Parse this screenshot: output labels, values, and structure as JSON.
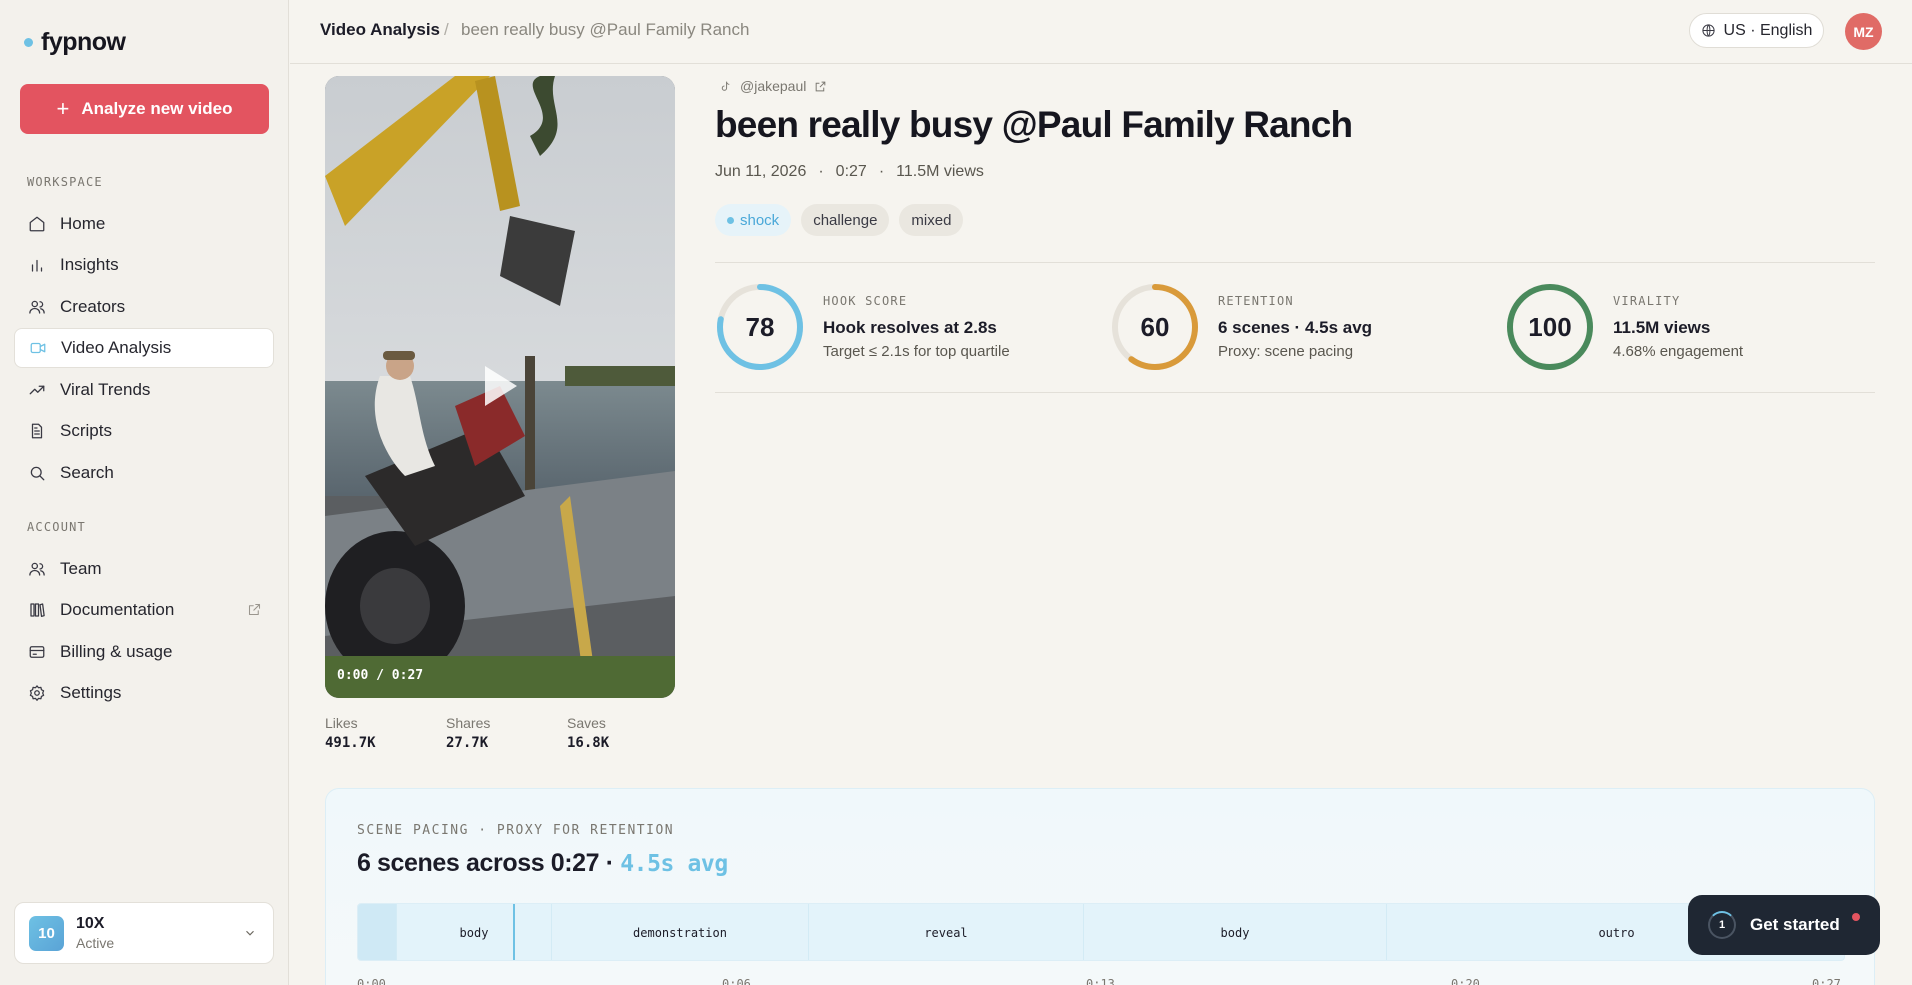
{
  "app": {
    "name": "fypnow"
  },
  "sidebar": {
    "analyze_label": "Analyze new video",
    "workspace_label": "WORKSPACE",
    "account_label": "ACCOUNT",
    "workspace_items": [
      {
        "label": "Home",
        "icon": "home-icon"
      },
      {
        "label": "Insights",
        "icon": "bar-chart-icon"
      },
      {
        "label": "Creators",
        "icon": "users-icon"
      },
      {
        "label": "Video Analysis",
        "icon": "video-icon",
        "active": true
      },
      {
        "label": "Viral Trends",
        "icon": "trending-icon"
      },
      {
        "label": "Scripts",
        "icon": "document-icon"
      },
      {
        "label": "Search",
        "icon": "search-icon"
      }
    ],
    "account_items": [
      {
        "label": "Team",
        "icon": "users-icon"
      },
      {
        "label": "Documentation",
        "icon": "book-icon"
      },
      {
        "label": "Billing & usage",
        "icon": "credit-card-icon"
      },
      {
        "label": "Settings",
        "icon": "gear-icon"
      }
    ],
    "workspace": {
      "badge": "10",
      "name": "10X",
      "status": "Active"
    }
  },
  "header": {
    "breadcrumb_main": "Video Analysis",
    "breadcrumb_sep": "/",
    "breadcrumb_sub": "been really busy @Paul Family Ranch",
    "language": "US · English",
    "avatar_initials": "MZ"
  },
  "video": {
    "time": "0:00 / 0:27",
    "stats": [
      {
        "label": "Likes",
        "value": "491.7K"
      },
      {
        "label": "Shares",
        "value": "27.7K"
      },
      {
        "label": "Saves",
        "value": "16.8K"
      }
    ]
  },
  "details": {
    "handle": "@jakepaul",
    "title": "been really busy @Paul Family Ranch",
    "date": "Jun 11, 2026",
    "duration": "0:27",
    "views": "11.5M views",
    "dot": "·",
    "tags": [
      "shock",
      "challenge",
      "mixed"
    ]
  },
  "scores": [
    {
      "value": "78",
      "fraction": 0.78,
      "color": "#6ec1e4",
      "label": "HOOK SCORE",
      "headline": "Hook resolves at 2.8s",
      "sub": "Target ≤ 2.1s for top quartile"
    },
    {
      "value": "60",
      "fraction": 0.6,
      "color": "#d99a3a",
      "label": "RETENTION",
      "headline": "6 scenes · 4.5s avg",
      "sub": "Proxy: scene pacing"
    },
    {
      "value": "100",
      "fraction": 1.0,
      "color": "#4a8a5c",
      "label": "VIRALITY",
      "headline": "11.5M views",
      "sub": "4.68% engagement"
    }
  ],
  "pacing": {
    "label": "SCENE PACING · PROXY FOR RETENTION",
    "title": "6 scenes across 0:27 ·",
    "avg": "4.5s avg",
    "scenes": [
      "",
      "body",
      "demonstration",
      "reveal",
      "body",
      "outro"
    ],
    "ticks": [
      "0:00",
      "0:06",
      "0:13",
      "0:20",
      "0:27"
    ]
  },
  "get_started": {
    "label": "Get started",
    "count": "1"
  }
}
